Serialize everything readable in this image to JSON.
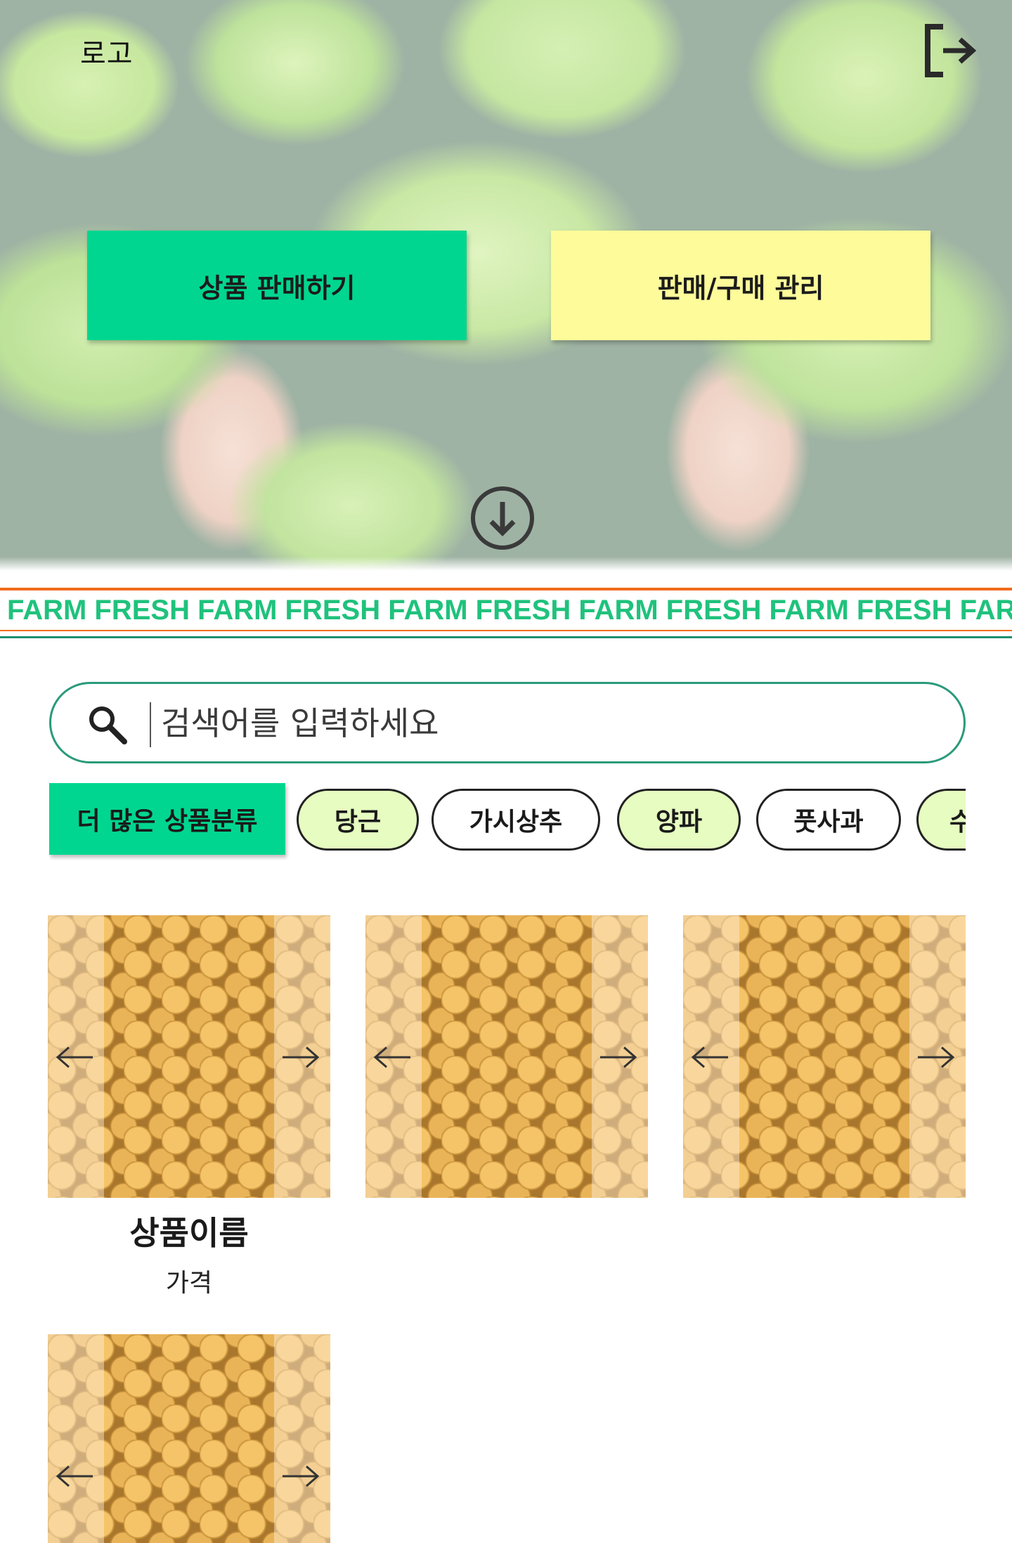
{
  "header": {
    "logo_text": "로고",
    "logout_icon": "logout-icon"
  },
  "hero": {
    "sell_button": "상품 판매하기",
    "manage_button": "판매/구매 관리",
    "scroll_icon": "arrow-down-circle-icon"
  },
  "marquee": {
    "text": "FARM FRESH FARM FRESH FARM FRESH FARM FRESH FARM FRESH FARM"
  },
  "search": {
    "placeholder": "검색어를 입력하세요",
    "icon": "search-icon"
  },
  "categories": {
    "more_label": "더 많은 상품분류",
    "chips": [
      {
        "label": "당근",
        "selected": true
      },
      {
        "label": "가시상추",
        "selected": false
      },
      {
        "label": "양파",
        "selected": true
      },
      {
        "label": "풋사과",
        "selected": false
      },
      {
        "label": "수",
        "selected": true
      }
    ]
  },
  "products": [
    {
      "name": "상품이름",
      "price": "가격"
    },
    {
      "name": "",
      "price": ""
    },
    {
      "name": "",
      "price": ""
    },
    {
      "name": "",
      "price": ""
    }
  ],
  "colors": {
    "primary_green": "#00d68f",
    "yellow": "#fdfb9a",
    "chip_selected": "#e6fcc0",
    "marquee_text": "#1fc27c",
    "orange_line": "#f26b1d",
    "teal_border": "#2a9a7b"
  }
}
